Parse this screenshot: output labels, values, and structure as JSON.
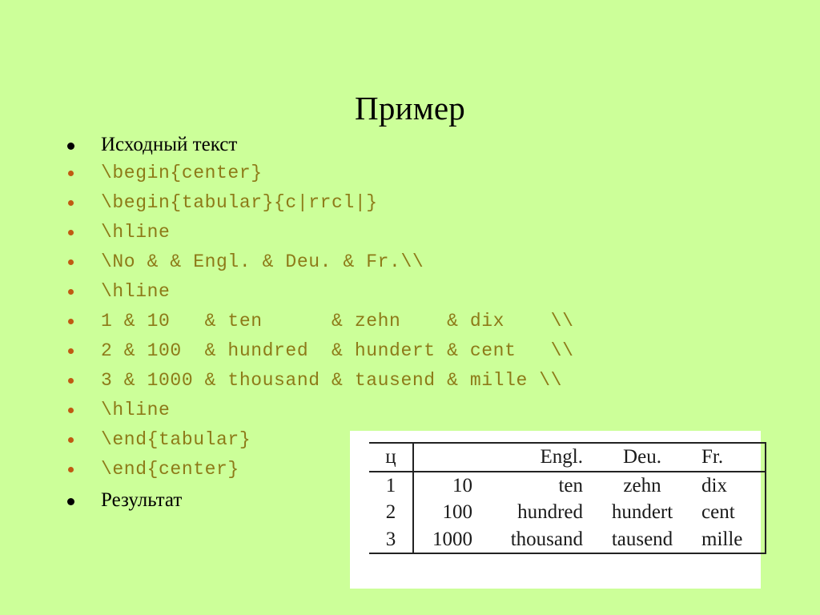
{
  "slide": {
    "title": "Пример",
    "background_color": "#ccff99",
    "title_color": "#000000",
    "code_color": "#8d7a18",
    "code_bullet_color": "#c05a12",
    "heading_bullet_color": "#000000"
  },
  "bullets": [
    {
      "kind": "heading",
      "text": "Исходный текст"
    },
    {
      "kind": "code",
      "text": "\\begin{center}"
    },
    {
      "kind": "code",
      "text": "\\begin{tabular}{c|rrcl|}"
    },
    {
      "kind": "code",
      "text": "\\hline"
    },
    {
      "kind": "code",
      "text": "\\No & & Engl. & Deu. & Fr.\\\\"
    },
    {
      "kind": "code",
      "text": "\\hline"
    },
    {
      "kind": "code",
      "text": "1 & 10   & ten      & zehn    & dix    \\\\"
    },
    {
      "kind": "code",
      "text": "2 & 100  & hundred  & hundert & cent   \\\\"
    },
    {
      "kind": "code",
      "text": "3 & 1000 & thousand & tausend & mille \\\\"
    },
    {
      "kind": "code",
      "text": "\\hline"
    },
    {
      "kind": "code",
      "text": "\\end{tabular}"
    },
    {
      "kind": "code",
      "text": "\\end{center}"
    },
    {
      "kind": "heading",
      "text": "Результат"
    }
  ],
  "result_table": {
    "header": [
      "ц",
      "",
      "Engl.",
      "Deu.",
      "Fr."
    ],
    "rows": [
      [
        "1",
        "10",
        "ten",
        "zehn",
        "dix"
      ],
      [
        "2",
        "100",
        "hundred",
        "hundert",
        "cent"
      ],
      [
        "3",
        "1000",
        "thousand",
        "tausend",
        "mille"
      ]
    ]
  }
}
